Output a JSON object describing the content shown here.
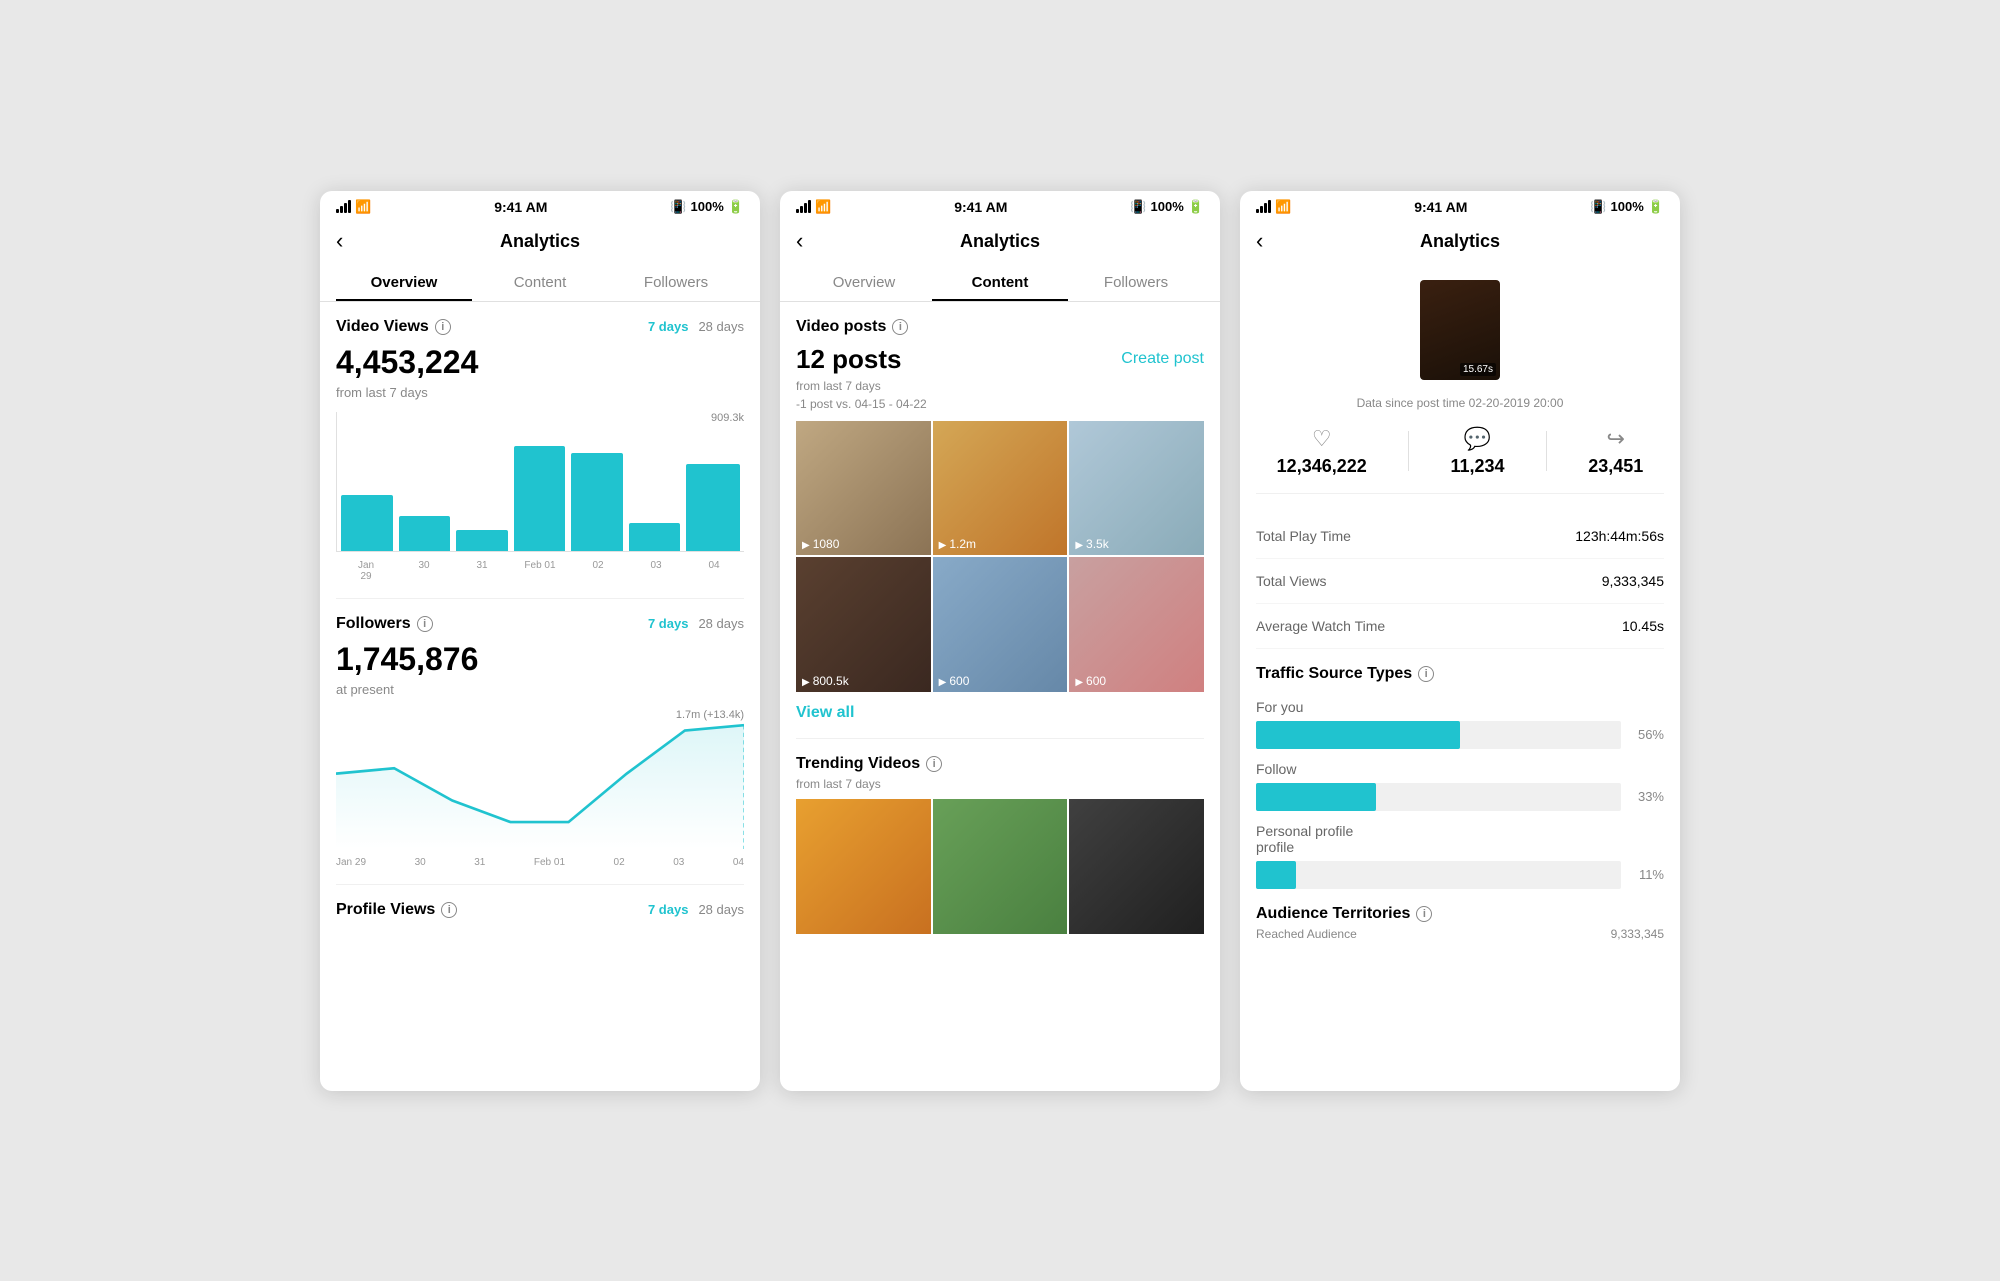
{
  "app": {
    "title": "Analytics"
  },
  "statusBar": {
    "time": "9:41 AM",
    "battery": "100%",
    "bluetooth": "BT"
  },
  "screen1": {
    "header": {
      "title": "Analytics",
      "back": "<"
    },
    "tabs": [
      {
        "label": "Overview",
        "active": true
      },
      {
        "label": "Content",
        "active": false
      },
      {
        "label": "Followers",
        "active": false
      }
    ],
    "videoViews": {
      "title": "Video Views",
      "periods": [
        "7 days",
        "28 days"
      ],
      "activePeriod": "7 days",
      "number": "4,453,224",
      "subtext": "from last 7 days",
      "peak": "909.3k",
      "barData": [
        40,
        25,
        15,
        75,
        70,
        20,
        65
      ],
      "barLabels": [
        "Jan 29",
        "30",
        "31",
        "Feb 01",
        "02",
        "03",
        "04"
      ]
    },
    "followers": {
      "title": "Followers",
      "periods": [
        "7 days",
        "28 days"
      ],
      "activePeriod": "7 days",
      "number": "1,745,876",
      "subtext": "at present",
      "peak": "1.7m (+13.4k)",
      "lineLabels": [
        "Jan 29",
        "30",
        "31",
        "Feb 01",
        "02",
        "03",
        "04"
      ]
    },
    "profileViews": {
      "title": "Profile Views",
      "periods": [
        "7 days",
        "28 days"
      ],
      "activePeriod": "7 days"
    }
  },
  "screen2": {
    "header": {
      "title": "Analytics",
      "back": "<"
    },
    "tabs": [
      {
        "label": "Overview",
        "active": false
      },
      {
        "label": "Content",
        "active": true
      },
      {
        "label": "Followers",
        "active": false
      }
    ],
    "videoPosts": {
      "title": "Video posts",
      "count": "12 posts",
      "createBtn": "Create post",
      "subtext": "from last 7 days",
      "comparison": "-1 post vs. 04-15 - 04-22",
      "posts": [
        {
          "views": "1080",
          "class": "thumb-city"
        },
        {
          "views": "1.2m",
          "class": "thumb-food"
        },
        {
          "views": "3.5k",
          "class": "thumb-snow"
        },
        {
          "views": "800.5k",
          "class": "thumb-corridor"
        },
        {
          "views": "600",
          "class": "thumb-venice"
        },
        {
          "views": "600",
          "class": "thumb-cafe"
        }
      ],
      "viewAll": "View all"
    },
    "trendingVideos": {
      "title": "Trending Videos",
      "subtext": "from last 7 days",
      "posts": [
        {
          "class": "thumb-food2"
        },
        {
          "class": "thumb-deer"
        },
        {
          "class": "thumb-dark"
        }
      ]
    }
  },
  "screen3": {
    "header": {
      "title": "Analytics",
      "back": "<"
    },
    "video": {
      "duration": "15.67s"
    },
    "dataSince": "Data since post time 02-20-2019 20:00",
    "stats": [
      {
        "icon": "♡",
        "value": "12,346,222"
      },
      {
        "icon": "💬",
        "value": "11,234"
      },
      {
        "icon": "↗",
        "value": "23,451"
      }
    ],
    "details": [
      {
        "label": "Total Play Time",
        "value": "123h:44m:56s"
      },
      {
        "label": "Total Views",
        "value": "9,333,345"
      },
      {
        "label": "Average Watch Time",
        "value": "10.45s"
      }
    ],
    "trafficSources": {
      "title": "Traffic Source Types",
      "items": [
        {
          "label": "For you",
          "pct": 56,
          "display": "56%"
        },
        {
          "label": "Follow",
          "pct": 33,
          "display": "33%"
        },
        {
          "label": "Personal profile\nprofile",
          "pct": 11,
          "display": "11%"
        }
      ]
    },
    "audienceTerritories": {
      "title": "Audience Territories",
      "subtitle": "Reached Audience",
      "value": "9,333,345"
    }
  }
}
